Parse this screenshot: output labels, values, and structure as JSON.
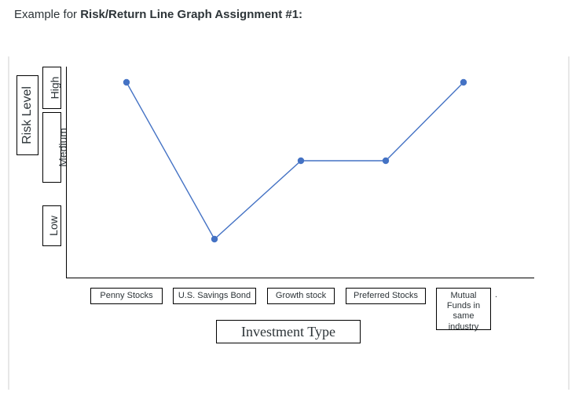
{
  "title": {
    "prefix": "Example for ",
    "bold": "Risk/Return Line Graph Assignment #1:"
  },
  "chart_data": {
    "type": "line",
    "title": "",
    "xlabel": "Investment Type",
    "ylabel": "Risk Level",
    "categories": [
      "Penny Stocks",
      "U.S. Savings Bond",
      "Growth stock",
      "Preferred Stocks",
      "Mutual Funds in same industry"
    ],
    "y_ticks": [
      "Low",
      "Medium",
      "High"
    ],
    "y_tick_map": {
      "Low": 1,
      "Medium": 2,
      "High": 3
    },
    "ylim": [
      0.5,
      3.2
    ],
    "values": [
      3.0,
      1.0,
      2.0,
      2.0,
      3.0
    ],
    "series": [
      {
        "name": "Risk Level",
        "values": [
          3.0,
          1.0,
          2.0,
          2.0,
          3.0
        ]
      }
    ],
    "accent_color": "#4472c4"
  }
}
